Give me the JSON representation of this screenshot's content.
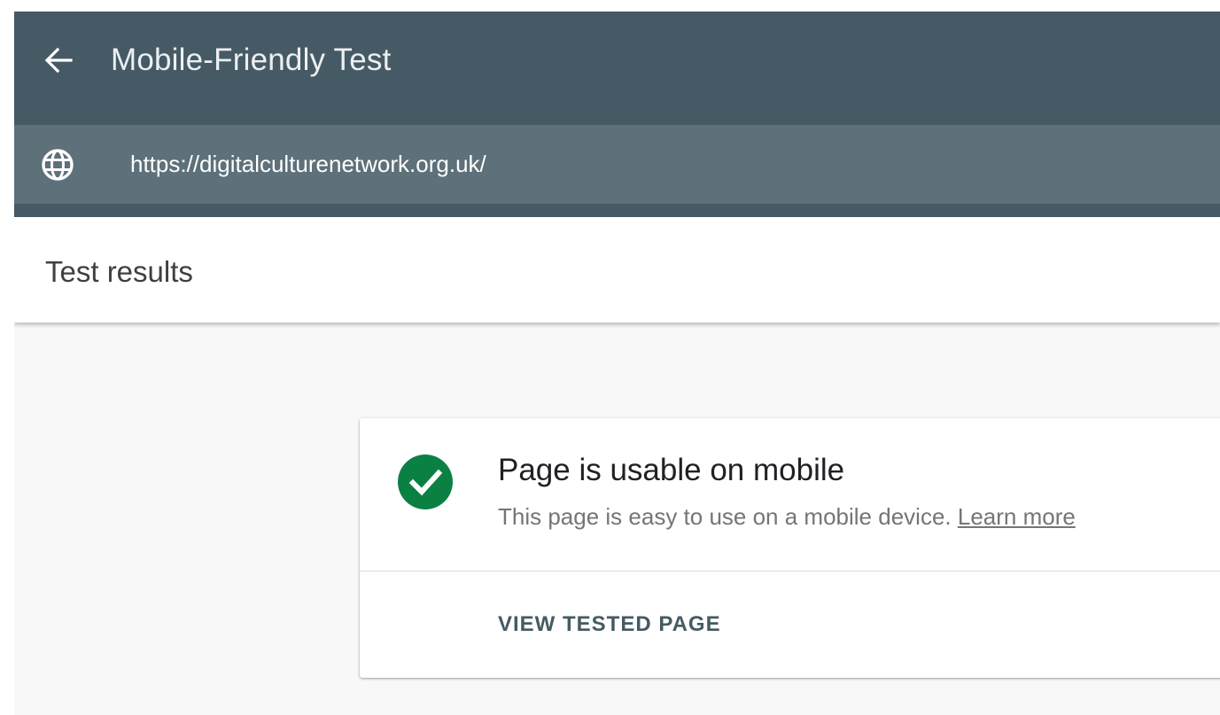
{
  "app_bar": {
    "title": "Mobile-Friendly Test",
    "back_icon": "arrow-left-icon",
    "background": "#455a64"
  },
  "url_bar": {
    "icon": "globe-icon",
    "url": "https://digitalculturenetwork.org.uk/",
    "background": "#5e7079"
  },
  "results": {
    "title": "Test results"
  },
  "card": {
    "status_icon": "check-circle-icon",
    "status_color": "#0b8043",
    "title": "Page is usable on mobile",
    "description": "This page is easy to use on a mobile device.",
    "learn_more": "Learn more",
    "view_button": "VIEW TESTED PAGE"
  }
}
